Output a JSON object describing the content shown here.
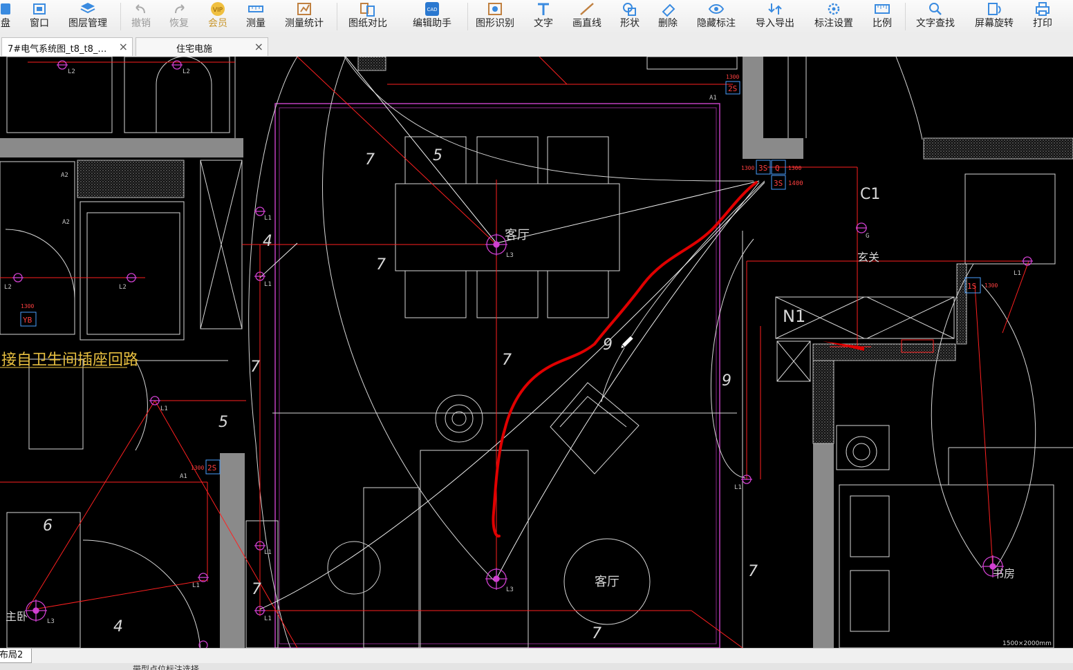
{
  "toolbar": {
    "items": [
      {
        "label": "盘",
        "icon": "disk-icon"
      },
      {
        "label": "窗口",
        "icon": "window-icon"
      },
      {
        "label": "图层管理",
        "icon": "layers-icon"
      },
      {
        "label": "撤销",
        "icon": "undo-icon",
        "disabled": true
      },
      {
        "label": "恢复",
        "icon": "redo-icon",
        "disabled": true
      },
      {
        "label": "会员",
        "icon": "vip-icon",
        "vip": true
      },
      {
        "label": "测量",
        "icon": "measure-icon"
      },
      {
        "label": "测量统计",
        "icon": "measure-stats-icon"
      },
      {
        "label": "图纸对比",
        "icon": "compare-icon"
      },
      {
        "label": "编辑助手",
        "icon": "cad-assistant-icon"
      },
      {
        "label": "图形识别",
        "icon": "shape-recognize-icon"
      },
      {
        "label": "文字",
        "icon": "text-icon"
      },
      {
        "label": "画直线",
        "icon": "line-icon"
      },
      {
        "label": "形状",
        "icon": "shape-icon"
      },
      {
        "label": "删除",
        "icon": "eraser-icon"
      },
      {
        "label": "隐藏标注",
        "icon": "eye-hide-icon"
      },
      {
        "label": "导入导出",
        "icon": "import-export-icon"
      },
      {
        "label": "标注设置",
        "icon": "annotation-settings-icon"
      },
      {
        "label": "比例",
        "icon": "scale-icon"
      },
      {
        "label": "文字查找",
        "icon": "text-search-icon"
      },
      {
        "label": "屏幕旋转",
        "icon": "rotate-screen-icon"
      },
      {
        "label": "打印",
        "icon": "print-icon"
      }
    ]
  },
  "tabs": [
    {
      "title": "7#电气系统图_t8_t8_…",
      "close": "×"
    },
    {
      "title": "住宅电施",
      "close": "×"
    }
  ],
  "drawing": {
    "rooms": {
      "living_top": "客厅",
      "living_bottom": "客厅",
      "master_bedroom": "主卧",
      "entrance": "玄关",
      "study": "书房"
    },
    "note": "接自卫生间插座回路",
    "circuit_labels": [
      "L1",
      "L2",
      "L3",
      "A1",
      "A2",
      "G",
      "C1",
      "N1"
    ],
    "socket_labels": [
      "2S",
      "3S",
      "Q",
      "YB",
      "1S"
    ],
    "heights": [
      "1300",
      "1400"
    ],
    "wire_counts": [
      "4",
      "5",
      "6",
      "7",
      "9"
    ],
    "size_note": "1500×2000mm",
    "colors": {
      "background": "#000000",
      "wall": "#ffffff",
      "circuit": "#ff2020",
      "border": "#c040c0",
      "fixture": "#d040d0",
      "markup": "#e00000",
      "hatch": "#888888"
    }
  },
  "layout": {
    "tab": "布局2"
  },
  "status": {
    "text": "带型点位标注选择"
  }
}
